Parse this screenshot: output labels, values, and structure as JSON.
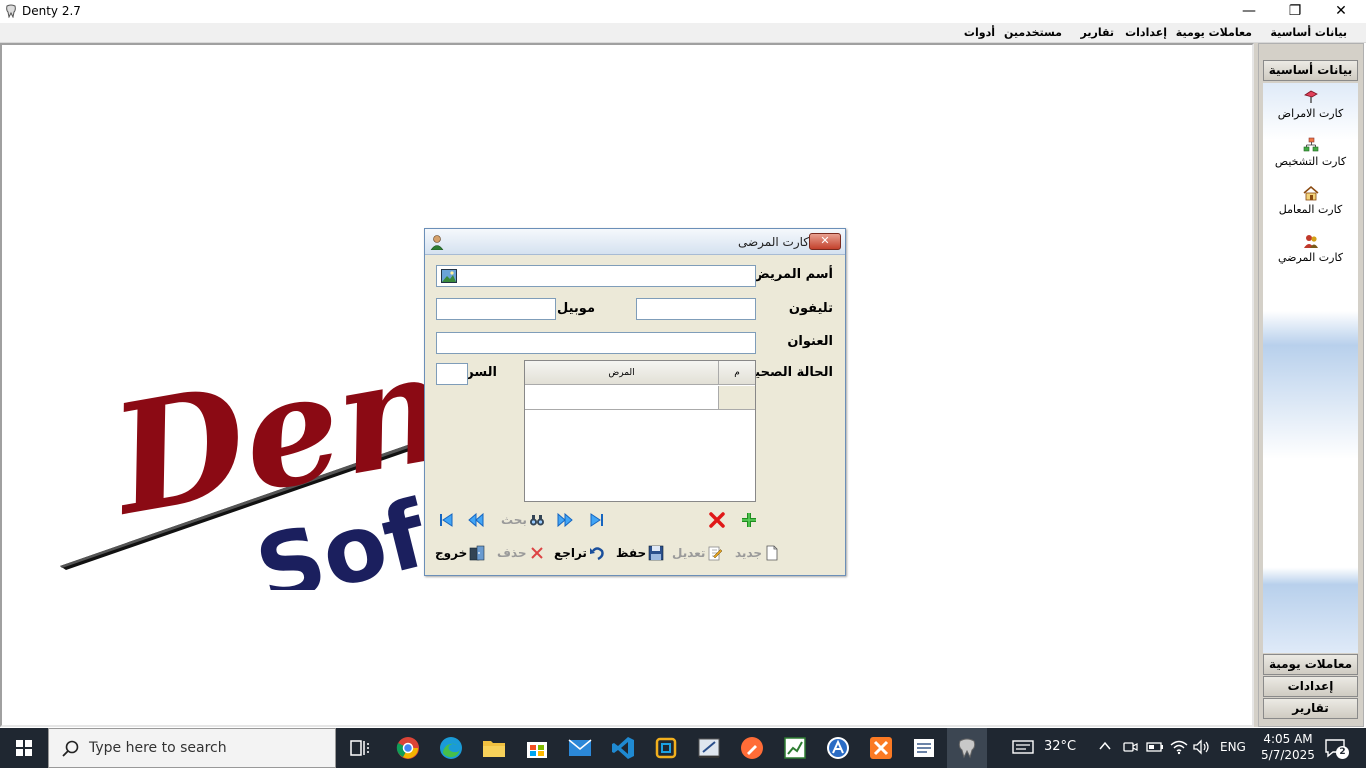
{
  "window": {
    "title": "Denty 2.7",
    "minimize_glyph": "—",
    "restore_glyph": "❐",
    "close_glyph": "✕"
  },
  "menu": {
    "items": [
      {
        "label": "بيانات أساسية"
      },
      {
        "label": "معاملات يومية"
      },
      {
        "label": "إعدادات"
      },
      {
        "label": "تقارير"
      },
      {
        "label": "مستخدمين"
      },
      {
        "label": "أدوات"
      }
    ]
  },
  "logo": {
    "line1": "Dent",
    "line2": "Sof"
  },
  "side_panel": {
    "sections": [
      {
        "label": "بيانات أساسية"
      },
      {
        "label": "معاملات يومية"
      },
      {
        "label": "إعدادات"
      },
      {
        "label": "تقارير"
      }
    ],
    "items": [
      {
        "label": "كارت الامراض",
        "icon": "disease-icon"
      },
      {
        "label": "كارت التشخيص",
        "icon": "diagnosis-icon"
      },
      {
        "label": "كارت المعامل",
        "icon": "lab-icon"
      },
      {
        "label": "كارت المرضي",
        "icon": "patients-icon"
      }
    ]
  },
  "dialog": {
    "title": "كارت المرضى",
    "close_glyph": "✕",
    "labels": {
      "patient_name": "أسم المريض",
      "phone": "تليفون",
      "mobile": "موبيل",
      "address": "العنوان",
      "health_status": "الحالة الصحية",
      "age": "السن"
    },
    "fields": {
      "patient_name": "",
      "phone": "",
      "mobile": "",
      "address": "",
      "age": ""
    },
    "grid": {
      "columns": [
        "م",
        "المرض"
      ]
    },
    "nav": {
      "search_label": "بحث"
    },
    "actions": {
      "new": "جديد",
      "edit": "تعديل",
      "save": "حفظ",
      "undo": "تراجع",
      "delete": "حذف",
      "exit": "خروج"
    }
  },
  "taskbar": {
    "search_placeholder": "Type here to search",
    "weather": "32°C",
    "language": "ENG",
    "time": "4:05 AM",
    "date": "5/7/2025",
    "notifications": "2"
  },
  "colors": {
    "logo_red": "#8b0a14",
    "logo_navy": "#1b1f5e",
    "dialog_bg": "#ece9d8",
    "taskbar_bg": "#1f2731"
  }
}
